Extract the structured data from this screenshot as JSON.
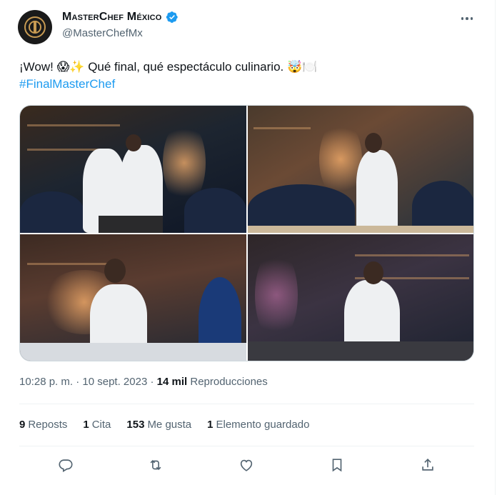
{
  "account": {
    "display_name": "MasterChef México",
    "handle": "@MasterChefMx",
    "avatar_icon": "masterchef-logo",
    "verified_icon": "verified-badge-icon",
    "verified_color": "#1d9bf0"
  },
  "more_icon": "more-dots-icon",
  "tweet": {
    "text": "¡Wow! 😱✨ Qué final, qué espectáculo culinario. 🤯🍽️",
    "text_main": "¡Wow! ",
    "text_emoji_1": "😱✨",
    "text_middle": " Qué final, qué espectáculo culinario. ",
    "text_emoji_2": "🤯🍽️",
    "hashtag": "#FinalMasterChef",
    "hashtag_color": "#1d9bf0"
  },
  "media": {
    "count": 4,
    "photos": [
      "photo-1",
      "photo-2",
      "photo-3",
      "photo-4"
    ]
  },
  "meta": {
    "time": "10:28 p. m.",
    "separator": " · ",
    "date": "10 sept. 2023",
    "views_count": "14 mil",
    "views_label": "Reproducciones"
  },
  "stats": {
    "reposts_count": "9",
    "reposts_label": "Reposts",
    "quotes_count": "1",
    "quotes_label": "Cita",
    "likes_count": "153",
    "likes_label": "Me gusta",
    "bookmarks_count": "1",
    "bookmarks_label": "Elemento guardado"
  },
  "actions": {
    "reply_icon": "reply-icon",
    "repost_icon": "repost-icon",
    "like_icon": "heart-icon",
    "bookmark_icon": "bookmark-icon",
    "share_icon": "share-icon",
    "icon_color": "#536471"
  }
}
